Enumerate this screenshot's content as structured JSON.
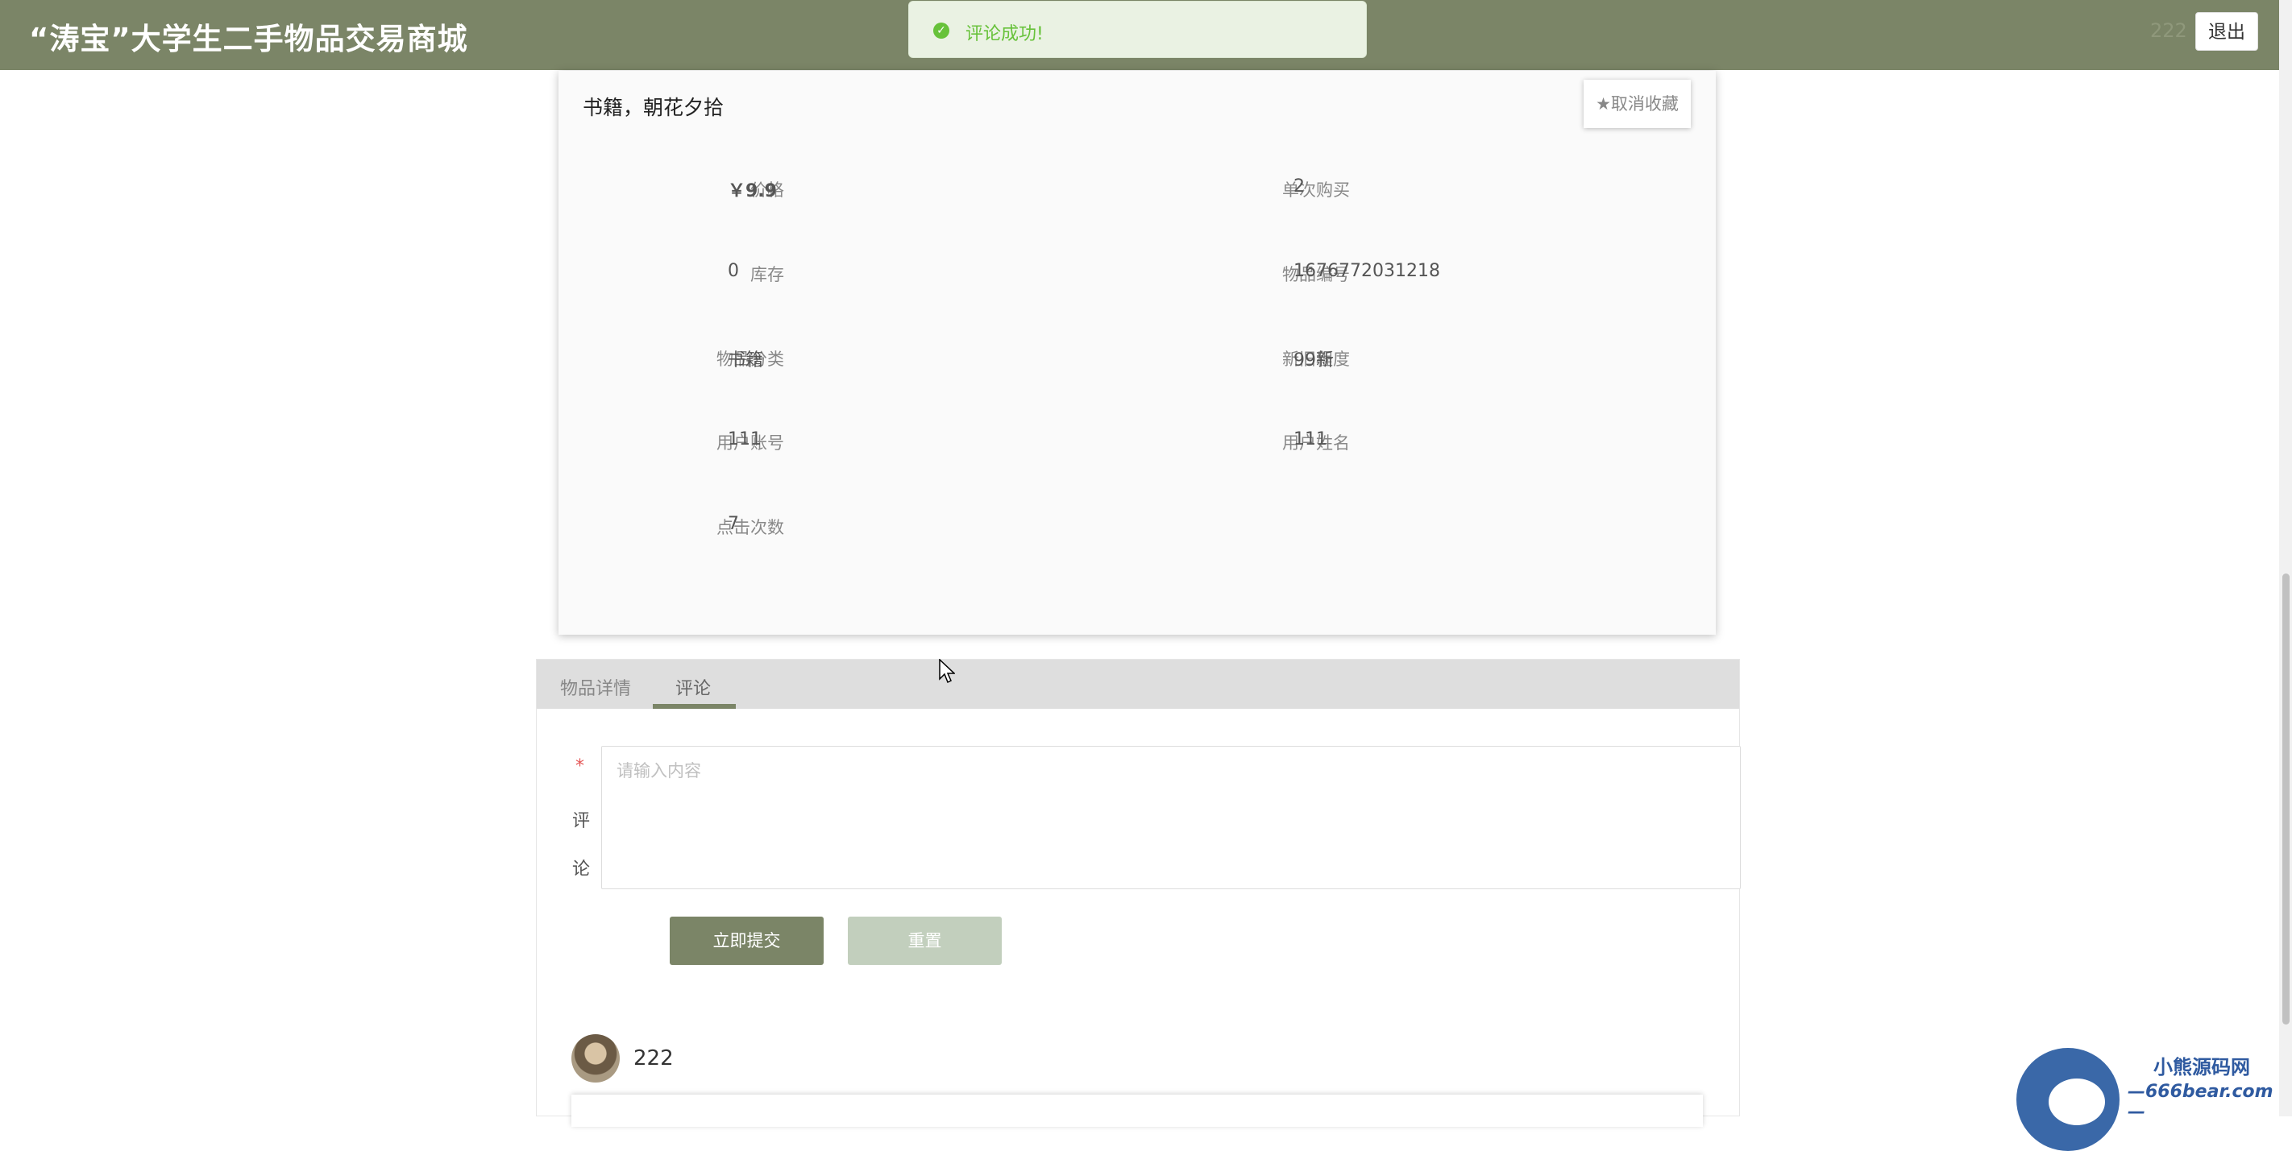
{
  "header": {
    "site_title": "“涛宝”大学生二手物品交易商城",
    "username": "222",
    "logout_label": "退出",
    "bg_color": "#7b8567"
  },
  "toast": {
    "icon": "check-circle-icon",
    "message": "评论成功!"
  },
  "product": {
    "name": "书籍，朝花夕拾",
    "unfavorite_label": "★取消收藏",
    "fields": {
      "price_label": "价格",
      "price_value": "￥9.9",
      "limit_label": "单次购买",
      "limit_value": "2",
      "stock_label": "库存",
      "stock_value": "0",
      "code_label": "物品编号",
      "code_value": "1676772031218",
      "category_label": "物品分类",
      "category_value": "书籍",
      "condition_label": "新旧程度",
      "condition_value": "99新",
      "account_label": "用户账号",
      "account_value": "111",
      "owner_label": "用户姓名",
      "owner_value": "111",
      "clicks_label": "点击次数",
      "clicks_value": "7"
    }
  },
  "tabs": {
    "items": [
      {
        "label": "物品详情",
        "active": false
      },
      {
        "label": "评论",
        "active": true
      }
    ]
  },
  "comment_form": {
    "required_mark": "*",
    "label_chars": [
      "评",
      "论"
    ],
    "placeholder": "请输入内容",
    "submit_label": "立即提交",
    "reset_label": "重置"
  },
  "comments": [
    {
      "username": "222"
    }
  ],
  "watermark": {
    "title": "小熊源码网",
    "url": "—666bear.com—"
  }
}
